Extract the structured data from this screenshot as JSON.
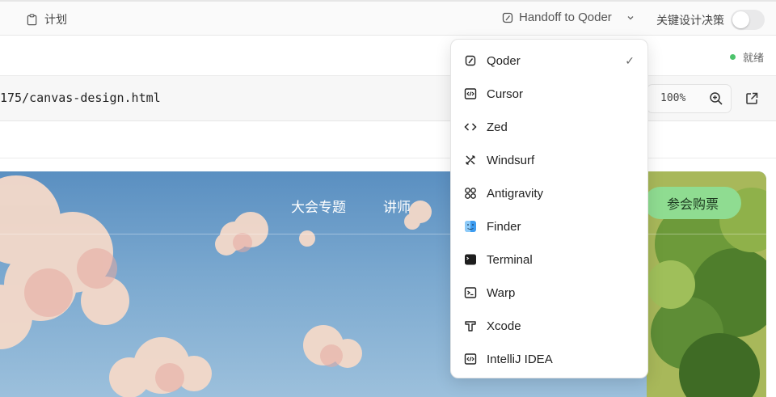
{
  "toolbar": {
    "plan_label": "计划",
    "handoff_label": "Handoff to Qoder",
    "decision_label": "关键设计决策",
    "decision_toggle": "off"
  },
  "status": {
    "label": "就绪",
    "color": "#4cc36b"
  },
  "address": {
    "url": "175/canvas-design.html",
    "zoom": "100%"
  },
  "preview": {
    "nav": [
      "大会专题",
      "讲师"
    ],
    "ticket_button": "参会购票"
  },
  "handoff_menu": {
    "items": [
      {
        "label": "Qoder",
        "icon": "qoder-icon",
        "checked": true
      },
      {
        "label": "Cursor",
        "icon": "cursor-icon"
      },
      {
        "label": "Zed",
        "icon": "zed-icon"
      },
      {
        "label": "Windsurf",
        "icon": "windsurf-icon"
      },
      {
        "label": "Antigravity",
        "icon": "antigravity-icon"
      },
      {
        "label": "Finder",
        "icon": "finder-icon"
      },
      {
        "label": "Terminal",
        "icon": "terminal-icon"
      },
      {
        "label": "Warp",
        "icon": "warp-icon"
      },
      {
        "label": "Xcode",
        "icon": "xcode-icon"
      },
      {
        "label": "IntelliJ IDEA",
        "icon": "intellij-icon"
      }
    ],
    "checkmark": "✓"
  }
}
